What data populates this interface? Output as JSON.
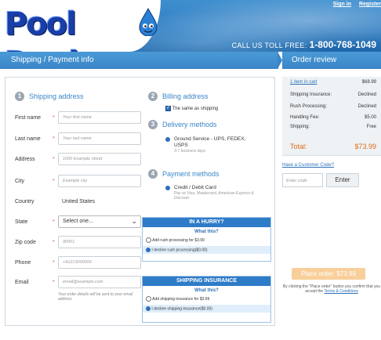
{
  "header": {
    "logo_text": "Pool Deals",
    "sign_in": "Sign in",
    "register": "Register",
    "phone_label": "CALL US TOLL FREE:",
    "phone_number": "1-800-768-1049"
  },
  "titles": {
    "left": "Shipping / Payment info",
    "right": "Order review"
  },
  "shipping": {
    "step": "1",
    "title": "Shipping address",
    "required_mark": "*",
    "fields": {
      "first_name": {
        "label": "First name",
        "placeholder": "Your first name"
      },
      "last_name": {
        "label": "Last name",
        "placeholder": "Your last name"
      },
      "address": {
        "label": "Address",
        "placeholder": "1000 Example street"
      },
      "city": {
        "label": "City",
        "placeholder": "Example city"
      },
      "country": {
        "label": "Country",
        "value": "United States"
      },
      "state": {
        "label": "State",
        "value": "Select one..."
      },
      "zip": {
        "label": "Zip code",
        "placeholder": "90001"
      },
      "phone": {
        "label": "Phone",
        "placeholder": "+41213000000"
      },
      "email": {
        "label": "Email",
        "placeholder": "email@example.com"
      }
    },
    "email_note": "Your order details will be sent to your email address"
  },
  "billing": {
    "step": "2",
    "title": "Billing address",
    "same_as_shipping": "The same as shipping"
  },
  "delivery": {
    "step": "3",
    "title": "Delivery methods",
    "option": "Ground Service - UPS, FEDEX, USPS",
    "sub": "3-7 business days"
  },
  "payment": {
    "step": "4",
    "title": "Payment methods",
    "option": "Credit / Debit Card",
    "sub": "Pay w/ Visa, Mastercard, American Express & Discover"
  },
  "hurry_box": {
    "header": "IN A HURRY?",
    "question": "What this?",
    "option1": "Add rush processing for $3.99",
    "option2": "I decline rush processing($0.00)"
  },
  "insurance_box": {
    "header": "SHIPPING INSURANCE",
    "question": "What this?",
    "option1": "Add shipping insurance for $3.99",
    "option2": "I decline shipping insurance($0.00)"
  },
  "order_review": {
    "rows": [
      {
        "label": "1 item in cart",
        "value": "$68.99"
      },
      {
        "label": "Shipping Insurance:",
        "value": "Declined"
      },
      {
        "label": "Rush Processing:",
        "value": "Declined"
      },
      {
        "label": "Handling Fee:",
        "value": "$5.00"
      },
      {
        "label": "Shipping:",
        "value": "Free"
      }
    ],
    "total_label": "Total:",
    "total_value": "$73.99"
  },
  "coupon": {
    "link": "Have a Customer Code?",
    "placeholder": "Enter code",
    "button": "Enter"
  },
  "place_order": {
    "button": "Place order: $73.99",
    "note_prefix": "By clicking the \"Place order\" button you confirm that you accept the",
    "terms": "Terms & Conditions"
  },
  "colors": {
    "accent": "#3a85c8",
    "total": "#e06a1b",
    "place_button": "#f8cf9a"
  }
}
